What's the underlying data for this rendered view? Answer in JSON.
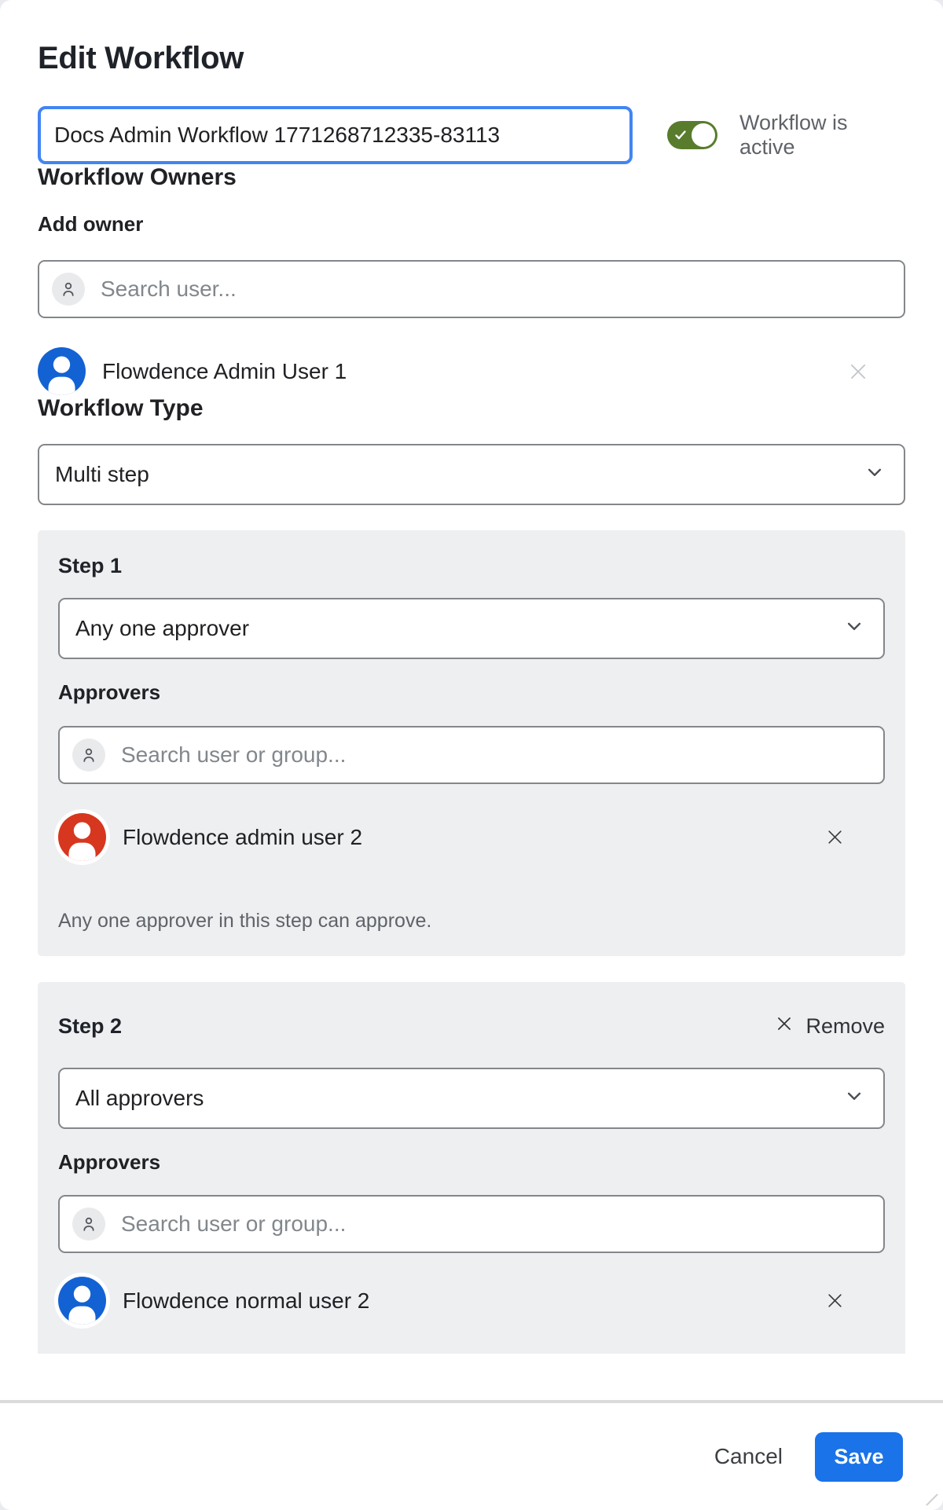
{
  "dialog": {
    "title": "Edit Workflow"
  },
  "name_field": {
    "value": "Docs Admin Workflow 1771268712335-83113"
  },
  "active_toggle": {
    "label": "Workflow is active",
    "state": "on"
  },
  "owners": {
    "heading": "Workflow Owners",
    "add_label": "Add owner",
    "search_placeholder": "Search user...",
    "users": [
      {
        "name": "Flowdence Admin User 1",
        "avatar_color": "#1362d3"
      }
    ]
  },
  "workflow_type": {
    "heading": "Workflow Type",
    "selected_option": "Multi step"
  },
  "steps": [
    {
      "title": "Step 1",
      "approval_mode": "Any one approver",
      "approvers_label": "Approvers",
      "search_placeholder": "Search user or group...",
      "users": [
        {
          "name": "Flowdence admin user 2",
          "avatar_color": "#d6371e"
        }
      ],
      "help_text": "Any one approver in this step can approve."
    },
    {
      "title": "Step 2",
      "remove_label": "Remove",
      "approval_mode": "All approvers",
      "approvers_label": "Approvers",
      "search_placeholder": "Search user or group...",
      "users": [
        {
          "name": "Flowdence normal user 2",
          "avatar_color": "#1362d3"
        }
      ]
    }
  ],
  "footer": {
    "cancel_label": "Cancel",
    "save_label": "Save"
  },
  "colors": {
    "toggle_on_green": "#587c2c",
    "save_button_blue": "#1a73e8",
    "focus_border_blue": "#4285f4",
    "step_background": "#eeeff1"
  }
}
